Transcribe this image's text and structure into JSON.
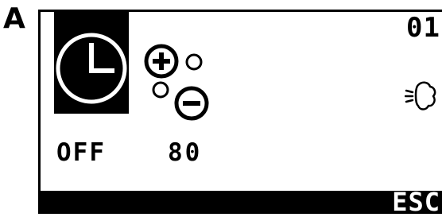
{
  "panel_label": "A",
  "display": {
    "channel": "01",
    "timer_state": "OFF",
    "setpoint": "80",
    "softkey_right": "ESC",
    "icons": {
      "timer": "clock-icon",
      "adjust": "plus-minus-icon",
      "mode": "fan-icon"
    },
    "colors": {
      "foreground": "#000000",
      "background": "#ffffff"
    }
  }
}
